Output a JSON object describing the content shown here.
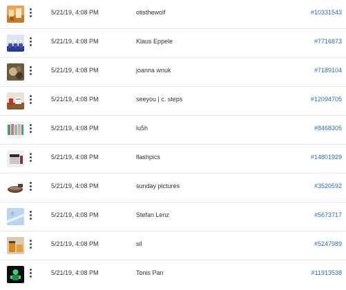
{
  "rows": [
    {
      "thumb": "orange-tea-jars-photo",
      "date": "5/21/19, 4:08 PM",
      "author": "otisthewolf",
      "id": "#10331543"
    },
    {
      "thumb": "blue-glass-bottles-photo",
      "date": "5/21/19, 4:08 PM",
      "author": "Klaus Eppele",
      "id": "#7716873"
    },
    {
      "thumb": "seeds-closeup-photo",
      "date": "5/21/19, 4:08 PM",
      "author": "joanna wnuk",
      "id": "#7189104"
    },
    {
      "thumb": "cosmetics-on-table-photo",
      "date": "5/21/19, 4:08 PM",
      "author": "seeyou | c. steps",
      "id": "#12094705"
    },
    {
      "thumb": "colorful-tubes-photo",
      "date": "5/21/19, 4:08 PM",
      "author": "lu5h",
      "id": "#8468305"
    },
    {
      "thumb": "jar-product-photo",
      "date": "5/21/19, 4:08 PM",
      "author": "flashpics",
      "id": "#14801929"
    },
    {
      "thumb": "brown-bowl-photo",
      "date": "5/21/19, 4:08 PM",
      "author": "sunday pictures",
      "id": "#3520592"
    },
    {
      "thumb": "light-blue-water-photo",
      "date": "5/21/19, 4:08 PM",
      "author": "Stefan Lenz",
      "id": "#5673717"
    },
    {
      "thumb": "honey-jars-photo",
      "date": "5/21/19, 4:08 PM",
      "author": "sil",
      "id": "#5247989"
    },
    {
      "thumb": "dark-green-figure-photo",
      "date": "5/21/19, 4:08 PM",
      "author": "Tonis Pan",
      "id": "#11913538"
    }
  ],
  "colors": {
    "link": "#2d6bb4",
    "divider": "#e6e6e6",
    "text": "#323232"
  }
}
